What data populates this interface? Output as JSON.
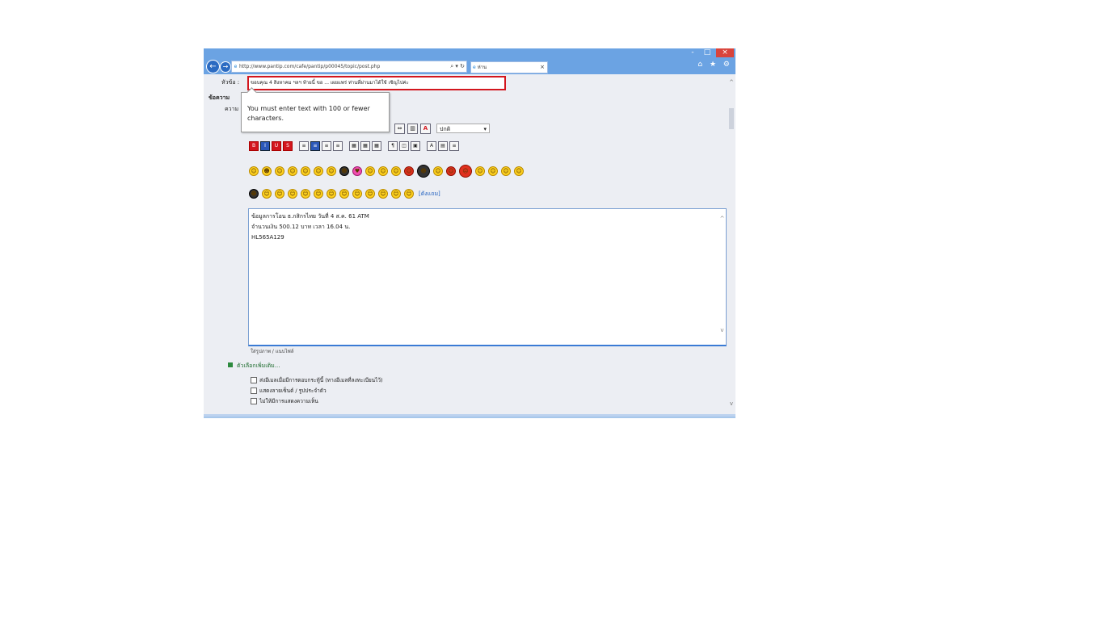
{
  "window": {
    "controls": {
      "minimize": "-",
      "maximize": "□",
      "close": "×"
    }
  },
  "browser": {
    "back_icon": "←",
    "forward_icon": "→",
    "address": "http://www.pantip.com/cafe/pantip/p00045/topic/post.php",
    "address_tools": "⌕ ▾ ↻",
    "tab_title": "ห่าน",
    "tab_close": "×",
    "right_icons": "⌂ ★ ⚙"
  },
  "form": {
    "title_label": "หัวข้อ :",
    "title_value": "ขอบคุณ 4 สิงหาคม ฯลฯ ท้ายนี้ ขอ ... เผยแพร่ ท่านที่ผ่านมาได้ใช้ เชิญไปค่ะ",
    "section_title": "ข้อความ",
    "section_sub": "ความ",
    "tooltip": "You must enter text with 100 or fewer characters."
  },
  "toolbar": {
    "row1_buttons": [
      "⇔",
      "▥",
      "A"
    ],
    "font_select": "ปกติ",
    "font_dd": "▾",
    "row2_buttons": [
      "B",
      "I",
      "U",
      "S",
      "≡",
      "≡",
      "≡",
      "≡",
      "▦",
      "▦",
      "▦",
      "¶",
      "◫",
      "▣",
      "A",
      "▤",
      "≡"
    ]
  },
  "emoticons": {
    "row1": [
      "☺",
      "☻",
      "☺",
      "☺",
      "☺",
      "☺",
      "☺",
      "☻",
      "♥",
      "☺",
      "☺",
      "☺",
      "☺",
      "☻",
      "☺",
      "☺",
      "☹",
      "☺",
      "☺",
      "☺",
      "☺"
    ],
    "row2": [
      "☻",
      "☺",
      "☺",
      "☺",
      "☺",
      "☺",
      "☺",
      "☺",
      "☺",
      "☺",
      "☺",
      "☺",
      "☺"
    ],
    "more_label": "[ดังแถม]"
  },
  "editor": {
    "line1": "ข้อมูลการโอน ธ.กสิกรไทย วันที่ 4 ส.ค. 61 ATM",
    "line2": "จำนวนเงิน 500.12 บาท เวลา 16.04 น.",
    "line3": "HL565A129",
    "scroll_up": "^",
    "scroll_down": "v"
  },
  "below_editor": "ใส่รูปภาพ / แนบไฟล์",
  "options": {
    "heading": "ตัวเลือกเพิ่มเติม...",
    "items": [
      "ส่งอีเมลเมื่อมีการตอบกระทู้นี้ (ทางอีเมลที่ลงทะเบียนไว้)",
      "แสดงลายเซ็นต์ / รูปประจำตัว",
      "ไม่ให้มีการแสดงความเห็น"
    ]
  },
  "scrollbar": {
    "up": "^",
    "down": "v"
  },
  "colors": {
    "browser_chrome": "#6ba3e3",
    "page_bg": "#eceef3",
    "error_border": "#d3161e",
    "editor_border": "#3a7bd5"
  }
}
